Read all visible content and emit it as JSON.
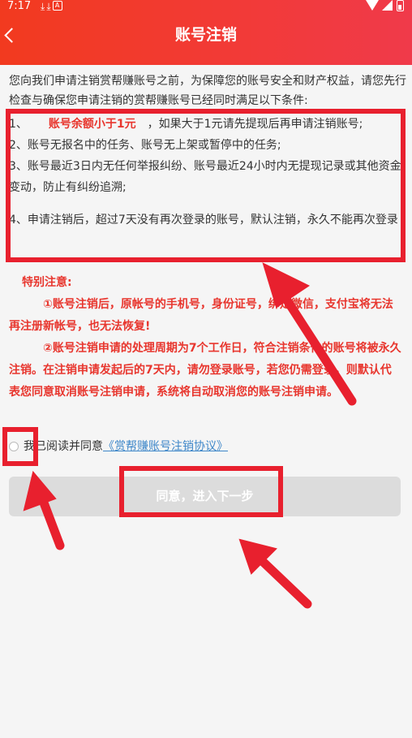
{
  "status_bar": {
    "time": "7:17",
    "icons": [
      "download-icon",
      "download-icon",
      "app-notification-icon"
    ],
    "app_icon_letter": "A"
  },
  "header": {
    "title": "账号注销"
  },
  "intro": "您向我们申请注销赏帮赚账号之前，为保障您的账号安全和财产权益，请您先行检查与确保您申请注销的赏帮赚账号已经同时满足以下条件:",
  "conditions": {
    "c1_prefix": "1、",
    "c1_highlight": "账号余额小于1元",
    "c1_suffix": "，如果大于1元请先提现后再申请注销账号;",
    "c2": "2、账号无报名中的任务、账号无上架或暂停中的任务;",
    "c3": "3、账号最近3日内无任何举报纠纷、账号最近24小时内无提现记录或其他资金变动，防止有纠纷追溯;",
    "c4": "4、申请注销后，超过7天没有再次登录的账号，默认注销，永久不能再次登录"
  },
  "notice": {
    "title": "特别注意:",
    "item1": "①账号注销后，原帐号的手机号，身份证号，绑定微信，支付宝将无法再注册新帐号，也无法恢复!",
    "item2": "②账号注销申请的处理周期为7个工作日，符合注销条件的账号将被永久注销。在注销申请发起后的7天内，请勿登录账号，若您仍需登录，则默认代表您同意取消账号注销申请，系统将自动取消您的账号注销申请。"
  },
  "agreement": {
    "text": "我已阅读并同意",
    "link": "《赏帮赚账号注销协议》",
    "checked": false
  },
  "next_button": {
    "label": "同意，进入下一步",
    "enabled": false
  },
  "colors": {
    "header": "#f23a36",
    "highlight": "#e8362e",
    "link": "#3e87c9",
    "annotation": "#e8202e",
    "button_disabled": "#dcdcdc"
  }
}
